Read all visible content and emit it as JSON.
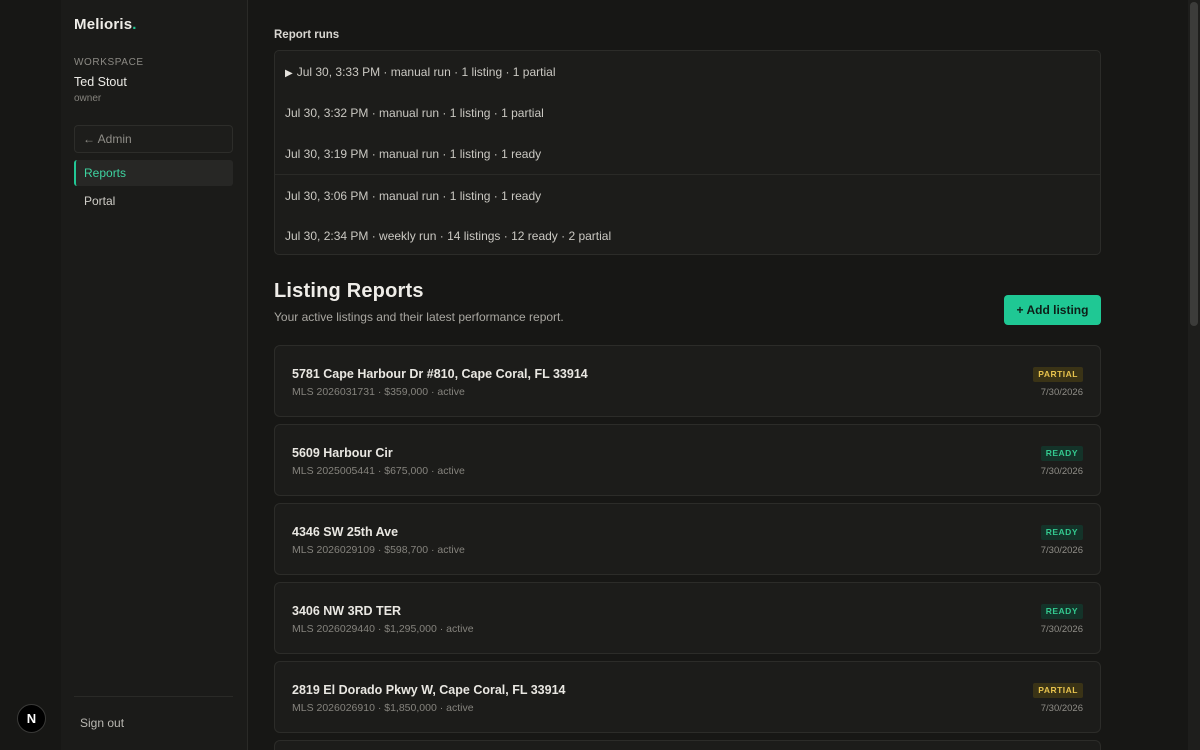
{
  "brand": {
    "name": "Melioris",
    "dot": "."
  },
  "workspace": {
    "label": "WORKSPACE",
    "name": "Ted Stout",
    "role": "owner"
  },
  "sidebar": {
    "admin_label": "← Admin",
    "items": [
      {
        "label": "Reports"
      },
      {
        "label": "Portal"
      }
    ],
    "sign_out": "Sign out",
    "dev_badge": "N"
  },
  "runs": {
    "title": "Report runs",
    "expand_icon": "play-triangle-icon",
    "items": [
      "Jul 30, 3:33 PM · manual run · 1 listing · 1 partial",
      "Jul 30, 3:32 PM · manual run · 1 listing · 1 partial",
      "Jul 30, 3:19 PM · manual run · 1 listing · 1 ready",
      "Jul 30, 3:06 PM · manual run · 1 listing · 1 ready",
      "Jul 30, 2:34 PM · weekly run · 14 listings · 12 ready · 2 partial"
    ]
  },
  "listings": {
    "title": "Listing Reports",
    "subtitle": "Your active listings and their latest performance report.",
    "add_button": "+ Add listing",
    "items": [
      {
        "address": "5781 Cape Harbour Dr #810, Cape Coral, FL 33914",
        "meta": "MLS 2026031731 · $359,000 · active",
        "status": "PARTIAL",
        "date": "7/30/2026"
      },
      {
        "address": "5609 Harbour Cir",
        "meta": "MLS 2025005441 · $675,000 · active",
        "status": "READY",
        "date": "7/30/2026"
      },
      {
        "address": "4346 SW 25th Ave",
        "meta": "MLS 2026029109 · $598,700 · active",
        "status": "READY",
        "date": "7/30/2026"
      },
      {
        "address": "3406 NW 3RD TER",
        "meta": "MLS 2026029440 · $1,295,000 · active",
        "status": "READY",
        "date": "7/30/2026"
      },
      {
        "address": "2819 El Dorado Pkwy W, Cape Coral, FL 33914",
        "meta": "MLS 2026026910 · $1,850,000 · active",
        "status": "PARTIAL",
        "date": "7/30/2026"
      }
    ]
  },
  "colors": {
    "accent": "#1fc894",
    "partial": "#e6c24d",
    "ready": "#34c98f",
    "background": "#171715"
  }
}
